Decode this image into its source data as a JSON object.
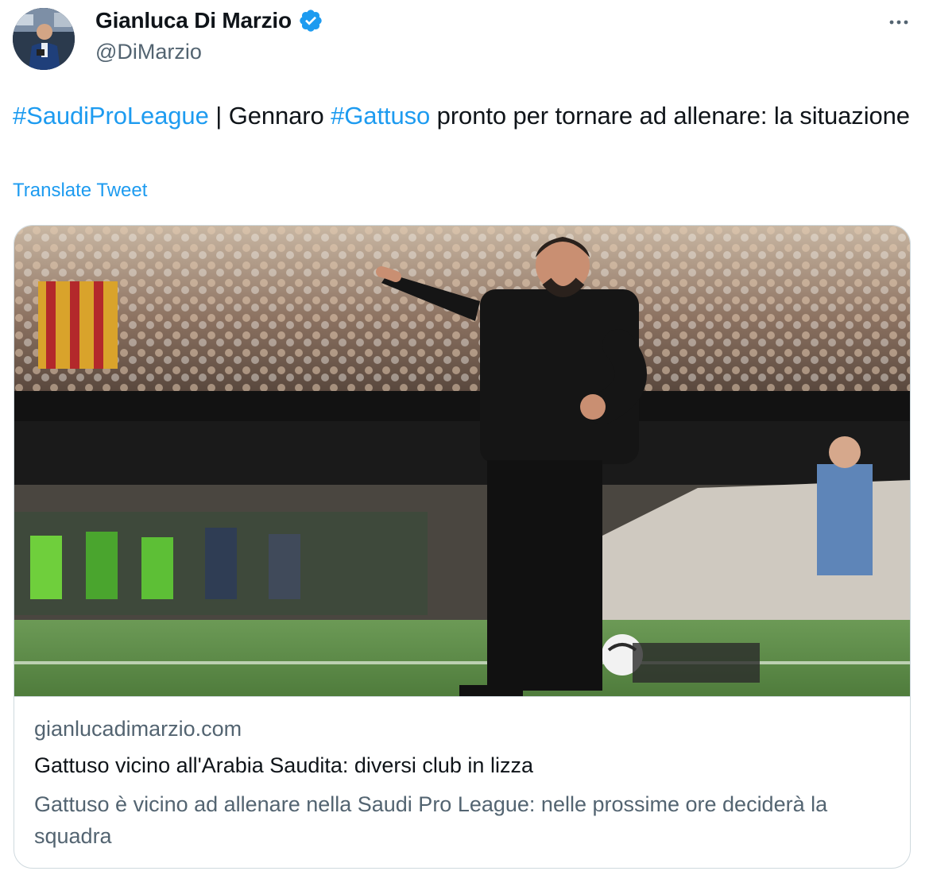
{
  "author": {
    "display_name": "Gianluca Di Marzio",
    "handle": "@DiMarzio",
    "verified": true,
    "verified_color": "#1d9bf0"
  },
  "tweet": {
    "text_parts": [
      {
        "type": "hashtag",
        "text": "#SaudiProLeague"
      },
      {
        "type": "text",
        "text": " | Gennaro "
      },
      {
        "type": "hashtag",
        "text": "#Gattuso"
      },
      {
        "type": "text",
        "text": " pronto per tornare ad allenare: la situazione"
      }
    ],
    "translate_label": "Translate Tweet"
  },
  "card": {
    "image_icon": "coach-pointing-photo",
    "domain": "gianlucadimarzio.com",
    "title": "Gattuso vicino all'Arabia Saudita: diversi club in lizza",
    "description": "Gattuso è vicino ad allenare nella Saudi Pro League: nelle prossime ore deciderà la squadra"
  },
  "icons": {
    "more": "more-dots-icon",
    "verified": "verified-badge-icon"
  },
  "colors": {
    "link": "#1d9bf0",
    "secondary_text": "#536471",
    "primary_text": "#0f1419",
    "border": "#cfd9de"
  }
}
